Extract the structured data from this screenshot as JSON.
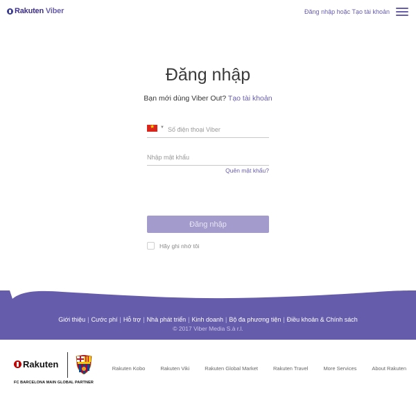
{
  "header": {
    "logo_prefix": "Rakuten",
    "logo_suffix": "Viber",
    "login_link": "Đăng nhập",
    "or_text": " hoặc ",
    "signup_link": "Tạo tài khoản"
  },
  "login": {
    "title": "Đăng nhập",
    "subtitle_text": "Bạn mới dùng Viber Out? ",
    "subtitle_link": "Tạo tài khoản",
    "phone_placeholder": "Số điện thoại Viber",
    "password_placeholder": "Nhập mật khẩu",
    "forgot_link": "Quên mật khẩu?",
    "submit_label": "Đăng nhập",
    "remember_label": "Hãy ghi nhớ tôi"
  },
  "footer": {
    "links": [
      "Giới thiệu",
      "Cước phí",
      "Hỗ trợ",
      "Nhà phát triển",
      "Kinh doanh",
      "Bộ đa phương tiện",
      "Điều khoản & Chính sách"
    ],
    "copyright": "© 2017 Viber Media S.à r.l."
  },
  "rakuten_bar": {
    "logo_text": "Rakuten",
    "partner_text": "FC BARCELONA MAIN GLOBAL PARTNER",
    "links": [
      "Rakuten Kobo",
      "Rakuten Viki",
      "Rakuten Global Market",
      "Rakuten Travel",
      "More Services",
      "About Rakuten"
    ]
  },
  "colors": {
    "brand_purple": "#665cac",
    "button_disabled": "#a29bcb",
    "rakuten_red": "#bf0000"
  },
  "icons": {
    "menu": "hamburger-menu-icon",
    "flag": "vietnam-flag-icon",
    "crest": "fc-barcelona-crest-icon"
  }
}
